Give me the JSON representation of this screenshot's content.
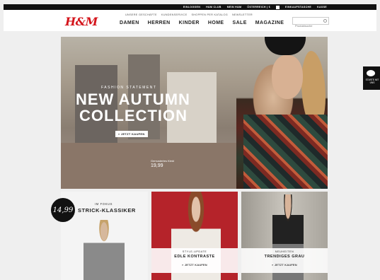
{
  "topbar": {
    "links": [
      "EINLOGGEN",
      "H&M CLUB",
      "MEIN H&M",
      "ÖSTERREICH | €"
    ],
    "basket": "EINKAUFSTASCHE",
    "checkout": "KASSE"
  },
  "header": {
    "logo": "H&M",
    "subnav": [
      "UNSERE GESCHÄFTE",
      "KUNDENSERVICE",
      "SHOPPEN PER KATALOG",
      "NEWSLETTER"
    ],
    "mainnav": [
      "DAMEN",
      "HERREN",
      "KINDER",
      "HOME",
      "SALE",
      "MAGAZINE"
    ],
    "search_placeholder": "Produktsuche"
  },
  "hero": {
    "kicker": "FASHION STATEMENT",
    "headline_line1": "NEW AUTUMN",
    "headline_line2": "COLLECTION",
    "cta": "» JETZT KAUFEN",
    "price_label": "Gemustertes Kleid",
    "price": "19,99"
  },
  "sidetab": {
    "label": "STARTE MIT UNS"
  },
  "tiles": [
    {
      "badge": "14,99",
      "kicker": "IM FOKUS",
      "title": "STRICK-KLASSIKER"
    },
    {
      "kicker": "STYLE-UPDATE",
      "title": "EDLE KONTRASTE",
      "cta": "» JETZT KAUFEN"
    },
    {
      "kicker": "NEUHEITEN",
      "title": "TRENDIGES GRAU",
      "cta": "» JETZT KAUFEN"
    }
  ]
}
